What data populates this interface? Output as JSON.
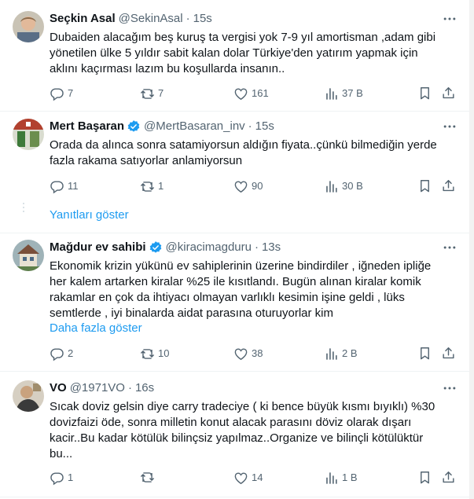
{
  "tweets": [
    {
      "name": "Seçkin Asal",
      "handle": "@SekinAsal",
      "time": "15s",
      "text": [
        "Dubaiden alacağım beş kuruş ta vergisi yok 7-9 yıl amortisman ,adam gibi",
        "yönetilen ülke 5 yıldır sabit kalan dolar Türkiye'den yatırım yapmak için",
        "aklını kaçırması lazım bu koşullarda insanın.."
      ],
      "replies": "7",
      "retweets": "7",
      "likes": "161",
      "views": "37 B"
    },
    {
      "name": "Mert Başaran",
      "handle": "@MertBasaran_inv",
      "time": "15s",
      "verified": true,
      "text": [
        "Orada da alınca sonra satamiyorsun aldığın fiyata..çünkü bilmediğin yerde",
        "fazla rakama satıyorlar anlamiyorsun"
      ],
      "replies": "11",
      "retweets": "1",
      "likes": "90",
      "views": "30 B"
    },
    {
      "name": "Mağdur ev sahibi",
      "handle": "@kiracimagduru",
      "time": "13s",
      "verified": true,
      "text": [
        "Ekonomik krizin yükünü ev sahiplerinin üzerine bindirdiler , iğneden ipliğe",
        "her kalem artarken kiralar %25 ile kısıtlandı. Bugün alınan kiralar komik",
        "rakamlar en çok da ihtiyacı olmayan varlıklı kesimin işine geldi , lüks",
        "semtlerde , iyi binalarda aidat parasına oturuyorlar kim"
      ],
      "show_more": "Daha fazla göster",
      "replies": "2",
      "retweets": "10",
      "likes": "38",
      "views": "2 B"
    },
    {
      "name": "VO",
      "handle": "@1971VO",
      "time": "16s",
      "text": [
        "Sıcak doviz gelsin diye carry tradeciye ( ki bence büyük kısmı bıyıklı) %30",
        "dovizfaizi öde, sonra milletin konut alacak parasını döviz olarak dışarı",
        "kacir..Bu kadar kötülük bilinçsiz yapılmaz..Organize ve bilinçli kötülüktür",
        "bu..."
      ],
      "replies": "1",
      "retweets": "",
      "likes": "14",
      "views": "1 B"
    }
  ],
  "show_replies": "Yanıtları göster",
  "colors": {
    "text": "#0f1419",
    "muted": "#536471",
    "accent": "#1d9bf0",
    "divider": "#eff3f4"
  },
  "icons": [
    "reply-icon",
    "retweet-icon",
    "like-icon",
    "views-icon",
    "bookmark-icon",
    "share-icon",
    "more-icon",
    "verified-icon"
  ]
}
